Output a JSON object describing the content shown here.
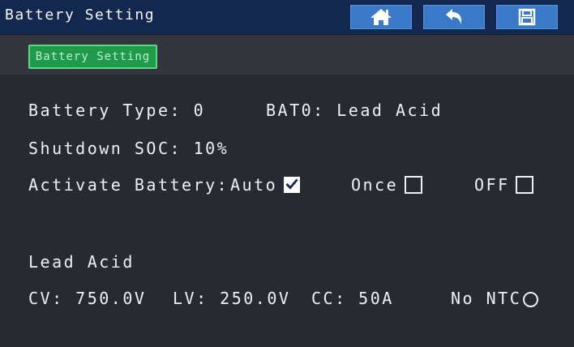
{
  "header": {
    "title": "Battery Setting",
    "buttons": [
      {
        "icon": "home-icon"
      },
      {
        "icon": "back-arrow-icon"
      },
      {
        "icon": "save-icon"
      }
    ]
  },
  "tabs": [
    {
      "label": "Battery Setting",
      "active": true
    }
  ],
  "settings": {
    "battery_type": "Battery Type: 0",
    "battery_type_name": "BAT0: Lead Acid",
    "shutdown_soc": "Shutdown SOC: 10%",
    "activate_label": "Activate Battery:",
    "activate_options": [
      {
        "label": "Auto",
        "checked": true
      },
      {
        "label": "Once",
        "checked": false
      },
      {
        "label": "OFF",
        "checked": false
      }
    ]
  },
  "lead_acid": {
    "heading": "Lead Acid",
    "cv": "CV: 750.0V",
    "lv": "LV: 250.0V",
    "cc": "CC: 50A",
    "ntc_label": "No NTC",
    "ntc_selected": false
  },
  "colors": {
    "titlebar": "#13284f",
    "button": "#3a79c8",
    "tab_active": "#1f9a4a",
    "background": "#272a30"
  }
}
